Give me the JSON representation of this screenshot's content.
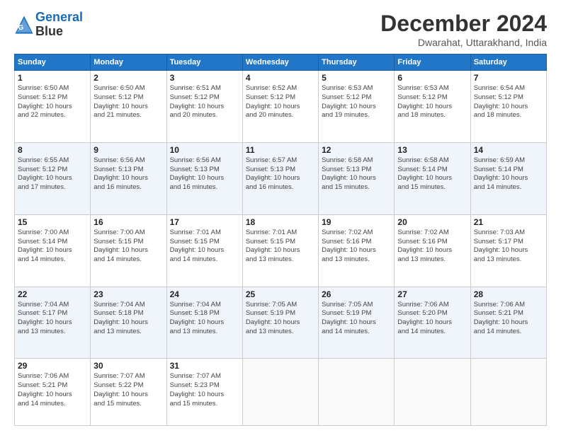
{
  "header": {
    "logo_line1": "General",
    "logo_line2": "Blue",
    "month_year": "December 2024",
    "location": "Dwarahat, Uttarakhand, India"
  },
  "weekdays": [
    "Sunday",
    "Monday",
    "Tuesday",
    "Wednesday",
    "Thursday",
    "Friday",
    "Saturday"
  ],
  "weeks": [
    [
      {
        "day": "1",
        "info": "Sunrise: 6:50 AM\nSunset: 5:12 PM\nDaylight: 10 hours\nand 22 minutes."
      },
      {
        "day": "2",
        "info": "Sunrise: 6:50 AM\nSunset: 5:12 PM\nDaylight: 10 hours\nand 21 minutes."
      },
      {
        "day": "3",
        "info": "Sunrise: 6:51 AM\nSunset: 5:12 PM\nDaylight: 10 hours\nand 20 minutes."
      },
      {
        "day": "4",
        "info": "Sunrise: 6:52 AM\nSunset: 5:12 PM\nDaylight: 10 hours\nand 20 minutes."
      },
      {
        "day": "5",
        "info": "Sunrise: 6:53 AM\nSunset: 5:12 PM\nDaylight: 10 hours\nand 19 minutes."
      },
      {
        "day": "6",
        "info": "Sunrise: 6:53 AM\nSunset: 5:12 PM\nDaylight: 10 hours\nand 18 minutes."
      },
      {
        "day": "7",
        "info": "Sunrise: 6:54 AM\nSunset: 5:12 PM\nDaylight: 10 hours\nand 18 minutes."
      }
    ],
    [
      {
        "day": "8",
        "info": "Sunrise: 6:55 AM\nSunset: 5:12 PM\nDaylight: 10 hours\nand 17 minutes."
      },
      {
        "day": "9",
        "info": "Sunrise: 6:56 AM\nSunset: 5:13 PM\nDaylight: 10 hours\nand 16 minutes."
      },
      {
        "day": "10",
        "info": "Sunrise: 6:56 AM\nSunset: 5:13 PM\nDaylight: 10 hours\nand 16 minutes."
      },
      {
        "day": "11",
        "info": "Sunrise: 6:57 AM\nSunset: 5:13 PM\nDaylight: 10 hours\nand 16 minutes."
      },
      {
        "day": "12",
        "info": "Sunrise: 6:58 AM\nSunset: 5:13 PM\nDaylight: 10 hours\nand 15 minutes."
      },
      {
        "day": "13",
        "info": "Sunrise: 6:58 AM\nSunset: 5:14 PM\nDaylight: 10 hours\nand 15 minutes."
      },
      {
        "day": "14",
        "info": "Sunrise: 6:59 AM\nSunset: 5:14 PM\nDaylight: 10 hours\nand 14 minutes."
      }
    ],
    [
      {
        "day": "15",
        "info": "Sunrise: 7:00 AM\nSunset: 5:14 PM\nDaylight: 10 hours\nand 14 minutes."
      },
      {
        "day": "16",
        "info": "Sunrise: 7:00 AM\nSunset: 5:15 PM\nDaylight: 10 hours\nand 14 minutes."
      },
      {
        "day": "17",
        "info": "Sunrise: 7:01 AM\nSunset: 5:15 PM\nDaylight: 10 hours\nand 14 minutes."
      },
      {
        "day": "18",
        "info": "Sunrise: 7:01 AM\nSunset: 5:15 PM\nDaylight: 10 hours\nand 13 minutes."
      },
      {
        "day": "19",
        "info": "Sunrise: 7:02 AM\nSunset: 5:16 PM\nDaylight: 10 hours\nand 13 minutes."
      },
      {
        "day": "20",
        "info": "Sunrise: 7:02 AM\nSunset: 5:16 PM\nDaylight: 10 hours\nand 13 minutes."
      },
      {
        "day": "21",
        "info": "Sunrise: 7:03 AM\nSunset: 5:17 PM\nDaylight: 10 hours\nand 13 minutes."
      }
    ],
    [
      {
        "day": "22",
        "info": "Sunrise: 7:04 AM\nSunset: 5:17 PM\nDaylight: 10 hours\nand 13 minutes."
      },
      {
        "day": "23",
        "info": "Sunrise: 7:04 AM\nSunset: 5:18 PM\nDaylight: 10 hours\nand 13 minutes."
      },
      {
        "day": "24",
        "info": "Sunrise: 7:04 AM\nSunset: 5:18 PM\nDaylight: 10 hours\nand 13 minutes."
      },
      {
        "day": "25",
        "info": "Sunrise: 7:05 AM\nSunset: 5:19 PM\nDaylight: 10 hours\nand 13 minutes."
      },
      {
        "day": "26",
        "info": "Sunrise: 7:05 AM\nSunset: 5:19 PM\nDaylight: 10 hours\nand 14 minutes."
      },
      {
        "day": "27",
        "info": "Sunrise: 7:06 AM\nSunset: 5:20 PM\nDaylight: 10 hours\nand 14 minutes."
      },
      {
        "day": "28",
        "info": "Sunrise: 7:06 AM\nSunset: 5:21 PM\nDaylight: 10 hours\nand 14 minutes."
      }
    ],
    [
      {
        "day": "29",
        "info": "Sunrise: 7:06 AM\nSunset: 5:21 PM\nDaylight: 10 hours\nand 14 minutes."
      },
      {
        "day": "30",
        "info": "Sunrise: 7:07 AM\nSunset: 5:22 PM\nDaylight: 10 hours\nand 15 minutes."
      },
      {
        "day": "31",
        "info": "Sunrise: 7:07 AM\nSunset: 5:23 PM\nDaylight: 10 hours\nand 15 minutes."
      },
      null,
      null,
      null,
      null
    ]
  ]
}
